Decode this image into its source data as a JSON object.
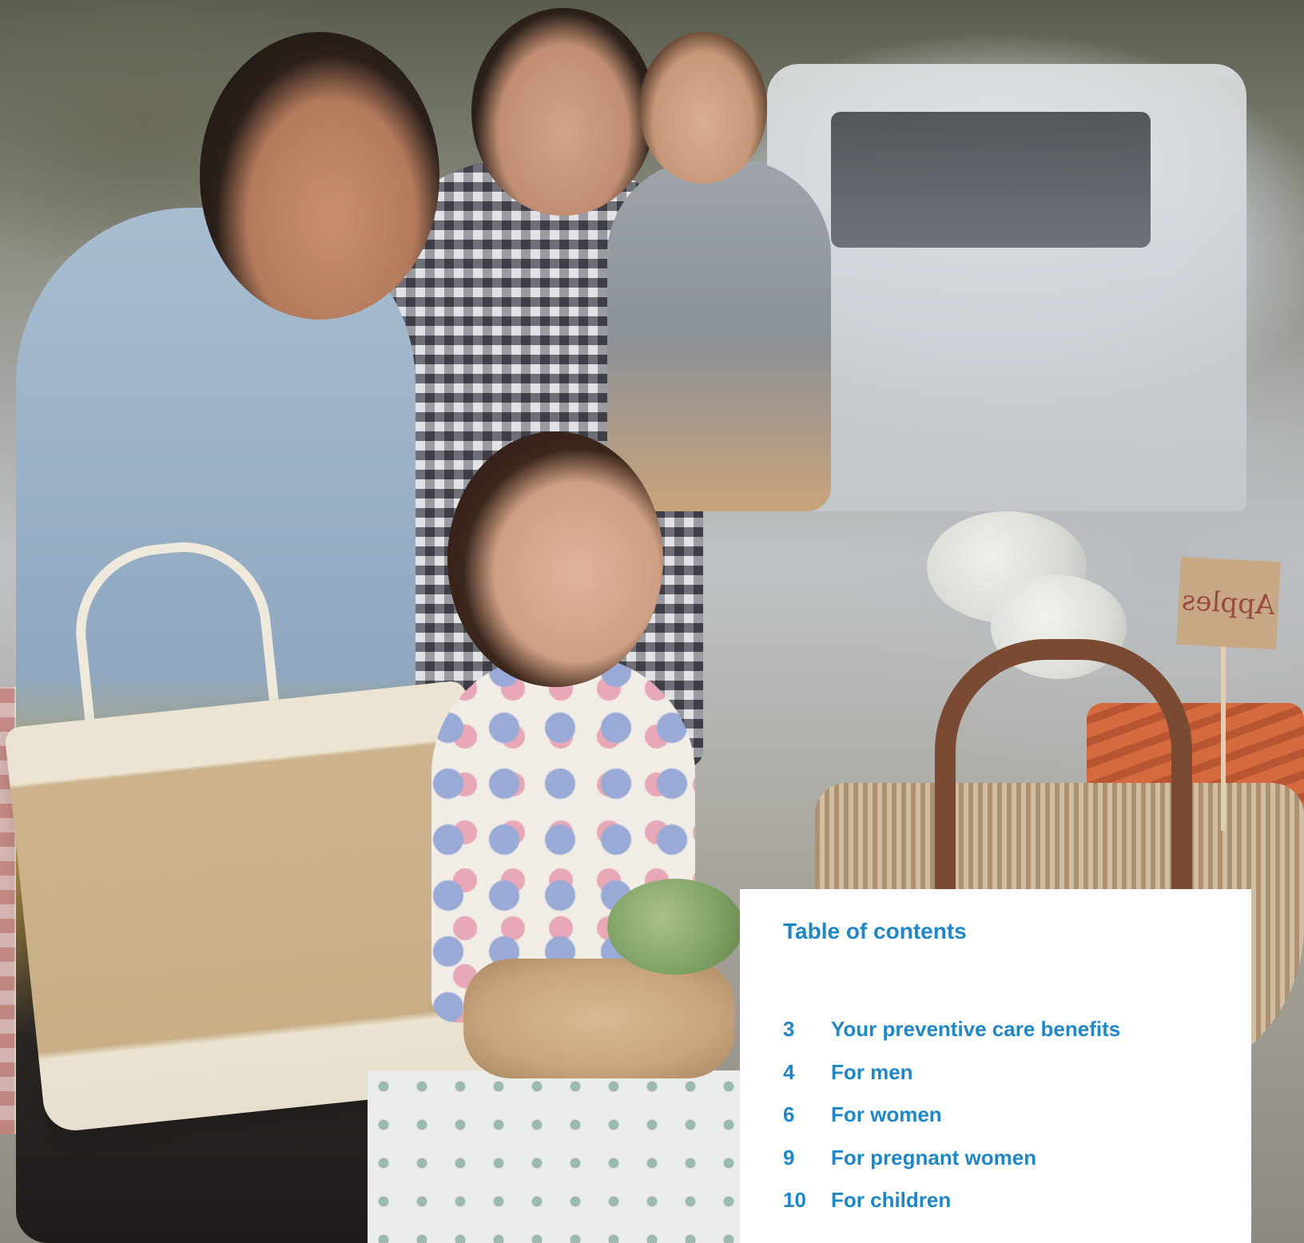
{
  "photo": {
    "sign_text": "Apples"
  },
  "toc": {
    "title": "Table of contents",
    "items": [
      {
        "page": "3",
        "label": "Your preventive care benefits"
      },
      {
        "page": "4",
        "label": "For men"
      },
      {
        "page": "6",
        "label": "For women"
      },
      {
        "page": "9",
        "label": "For pregnant women"
      },
      {
        "page": "10",
        "label": "For children"
      }
    ],
    "accent_color": "#1f86c8"
  }
}
